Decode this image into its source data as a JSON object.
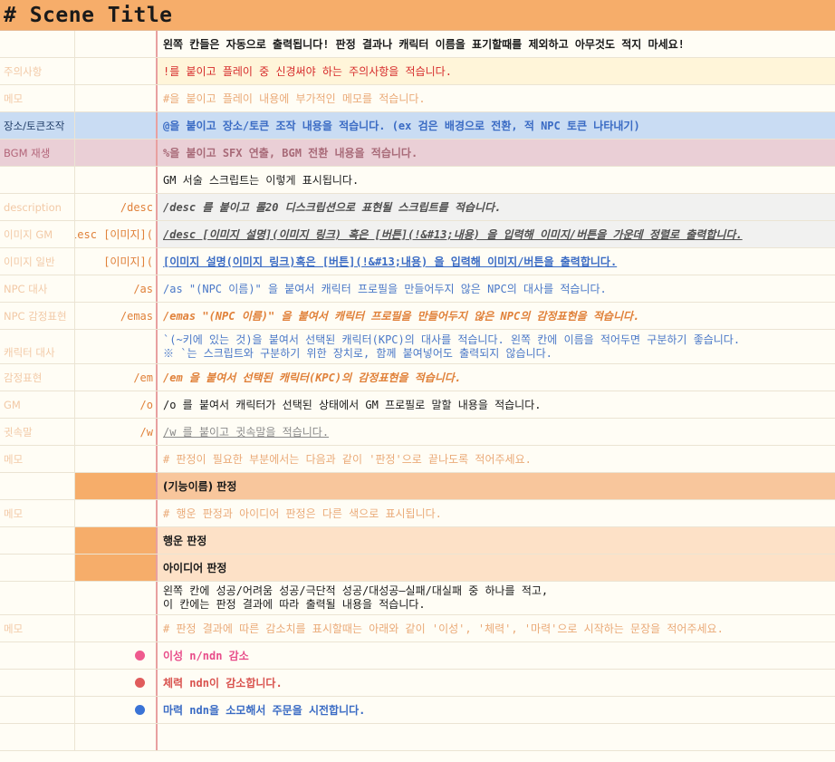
{
  "title": "# Scene Title",
  "colors": {
    "header": "#f6ad6a",
    "pink_dot": "#ef5a8e",
    "red_dot": "#e05c5c",
    "blue_dot": "#3a73d6"
  },
  "rows": [
    {
      "k": "",
      "c": "",
      "t": "왼쪽 칸들은 자동으로 출력됩니다! 판정 결과나 캐릭터 이름을 표기할때를 제외하고 아무것도 적지 마세요!"
    },
    {
      "k": "주의사항",
      "c": "",
      "t": "!를 붙이고 플레이 중 신경써야 하는 주의사항을 적습니다."
    },
    {
      "k": "메모",
      "c": "",
      "t": "#을 붙이고 플레이 내용에 부가적인 메모를 적습니다."
    },
    {
      "k": "장소/토큰조작",
      "c": "",
      "t": "@을 붙이고 장소/토큰 조작 내용을 적습니다. (ex 검은 배경으로 전환, 적 NPC 토큰 나타내기)"
    },
    {
      "k": "BGM 재생",
      "c": "",
      "t": "%을 붙이고 SFX 연출, BGM 전환 내용을 적습니다."
    },
    {
      "k": "",
      "c": "",
      "t": "GM 서술 스크립트는 이렇게 표시됩니다."
    },
    {
      "k": "description",
      "c": "/desc",
      "t": "/desc 를 붙이고 롤20 디스크립션으로 표현될 스크립트를 적습니다."
    },
    {
      "k": "이미지 GM",
      "c": "lesc [이미지](",
      "t": "/desc [이미지 설명](이미지 링크) 혹은 [버튼](!&#13;내용) 을 입력해 이미지/버튼을 가운데 정렬로 출력합니다."
    },
    {
      "k": "이미지 일반",
      "c": "[이미지](",
      "t": "[이미지 설명(이미지 링크)혹은 [버튼](!&#13;내용) 을 입력해 이미지/버튼을 출력합니다."
    },
    {
      "k": "NPC 대사",
      "c": "/as",
      "t": "/as \"(NPC 이름)\" 을 붙여서 캐릭터 프로필을 만들어두지 않은 NPC의 대사를 적습니다."
    },
    {
      "k": "NPC 감정표현",
      "c": "/emas",
      "t": "/emas \"(NPC 이름)\" 을 붙여서 캐릭터 프로필을 만들어두지 않은 NPC의 감정표현을 적습니다."
    },
    {
      "k": "캐릭터 대사",
      "c": "",
      "t": "`(~키에 있는 것)을 붙여서 선택된 캐릭터(KPC)의 대사를 적습니다. 왼쪽 칸에 이름을 적어두면 구분하기 좋습니다.",
      "t2": "※ `는 스크립트와 구분하기 위한 장치로, 함께 붙여넣어도 출력되지 않습니다."
    },
    {
      "k": "감정표현",
      "c": "/em",
      "t": "/em 을 붙여서 선택된 캐릭터(KPC)의 감정표현을 적습니다."
    },
    {
      "k": "GM",
      "c": "/o",
      "t": "/o 를 붙여서 캐릭터가 선택된 상태에서 GM 프로필로 말할 내용을 적습니다."
    },
    {
      "k": "귓속말",
      "c": "/w",
      "t": "/w 를 붙이고 귓속말을 적습니다."
    },
    {
      "k": "메모",
      "c": "",
      "t": "# 판정이 필요한 부분에서는 다음과 같이 '판정'으로 끝나도록 적어주세요."
    },
    {
      "k": "",
      "c": "",
      "t": "(기능이름) 판정"
    },
    {
      "k": "메모",
      "c": "",
      "t": "# 행운 판정과 아이디어 판정은 다른 색으로 표시됩니다."
    },
    {
      "k": "",
      "c": "",
      "t": "행운 판정"
    },
    {
      "k": "",
      "c": "",
      "t": "아이디어 판정"
    },
    {
      "k": "",
      "c": "",
      "t": "왼쪽 칸에 성공/어려움 성공/극단적 성공/대성공―실패/대실패 중 하나를 적고,",
      "t2": "이 칸에는 판정 결과에 따라 출력될 내용을 적습니다."
    },
    {
      "k": "메모",
      "c": "",
      "t": "# 판정 결과에 따른 감소치를 표시할때는 아래와 같이 '이성', '체력', '마력'으로 시작하는 문장을 적어주세요."
    },
    {
      "k": "",
      "c": "",
      "t": "이성 n/ndn 감소"
    },
    {
      "k": "",
      "c": "",
      "t": "체력 ndn이 감소합니다."
    },
    {
      "k": "",
      "c": "",
      "t": "마력 ndn을 소모해서 주문을 시전합니다."
    },
    {
      "k": "",
      "c": "",
      "t": ""
    }
  ]
}
